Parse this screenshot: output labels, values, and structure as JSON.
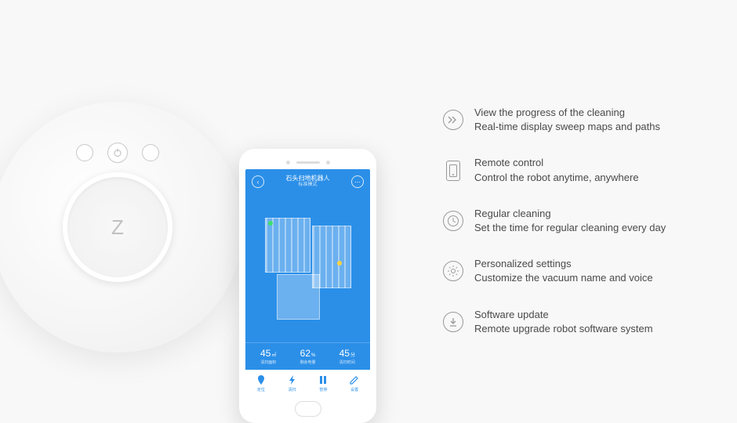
{
  "robot": {
    "logo": "Z"
  },
  "phone": {
    "title": "石头扫地机器人",
    "subtitle": "标准模式",
    "stats": [
      {
        "value": "45",
        "unit": "㎡",
        "label": "清扫面积"
      },
      {
        "value": "62",
        "unit": "%",
        "label": "剩余电量"
      },
      {
        "value": "45",
        "unit": "分",
        "label": "清扫时间"
      }
    ],
    "nav": [
      "定位",
      "清扫",
      "暂停",
      "设置"
    ]
  },
  "features": [
    {
      "title": "View the progress of the cleaning",
      "sub": "Real-time display sweep maps and paths",
      "icon": "progress"
    },
    {
      "title": "Remote control",
      "sub": "Control  the robot anytime, anywhere",
      "icon": "phone"
    },
    {
      "title": "Regular cleaning",
      "sub": "Set the time for regular cleaning every day",
      "icon": "clock"
    },
    {
      "title": "Personalized settings",
      "sub": "Customize the vacuum name and voice",
      "icon": "gear"
    },
    {
      "title": "Software update",
      "sub": "Remote upgrade robot software system",
      "icon": "download"
    }
  ]
}
